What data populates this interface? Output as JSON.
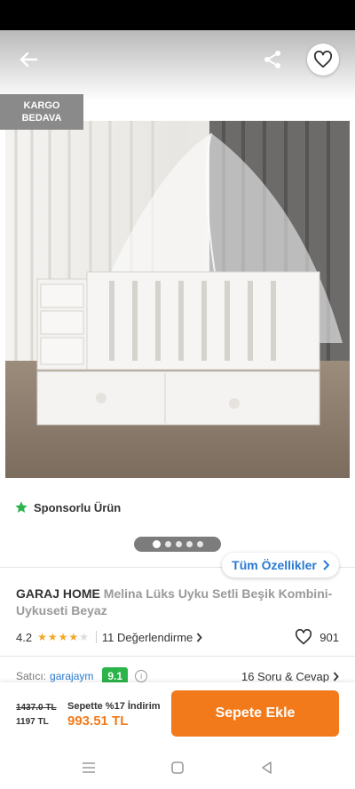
{
  "header": {
    "back_icon": "arrow-left-icon",
    "share_icon": "share-icon",
    "favorite_icon": "heart-outline-icon"
  },
  "badge": {
    "line1": "KARGO",
    "line2": "BEDAVA"
  },
  "sponsored": {
    "icon": "star-icon",
    "label": "Sponsorlu Ürün"
  },
  "gallery": {
    "dot_count": 5,
    "active_index": 0
  },
  "all_features_button": "Tüm Özellikler",
  "product": {
    "brand": "GARAJ HOME",
    "name": "Melina Lüks Uyku Setli Beşik Kombini- Uykuseti Beyaz"
  },
  "rating": {
    "score": "4.2",
    "stars": 4,
    "reviews_label": "11 Değerlendirme",
    "favorite_count": "901"
  },
  "seller": {
    "label": "Satıcı:",
    "name": "garajaym",
    "score": "9.1",
    "qa_label": "16 Soru & Cevap"
  },
  "price": {
    "original": "1437.0 TL",
    "base": "1197 TL",
    "discount_label": "Sepette %17 İndirim",
    "final": "993.51 TL"
  },
  "cart_button": "Sepete Ekle",
  "colors": {
    "brand_orange": "#f27a1a",
    "link_blue": "#2879d0",
    "seller_score_green": "#2bb44a",
    "star_yellow": "#f5a623",
    "sponsor_green": "#2bb44a"
  },
  "nav": {
    "menu_icon": "menu-icon",
    "home_icon": "home-square-icon",
    "back_icon": "back-triangle-icon"
  }
}
